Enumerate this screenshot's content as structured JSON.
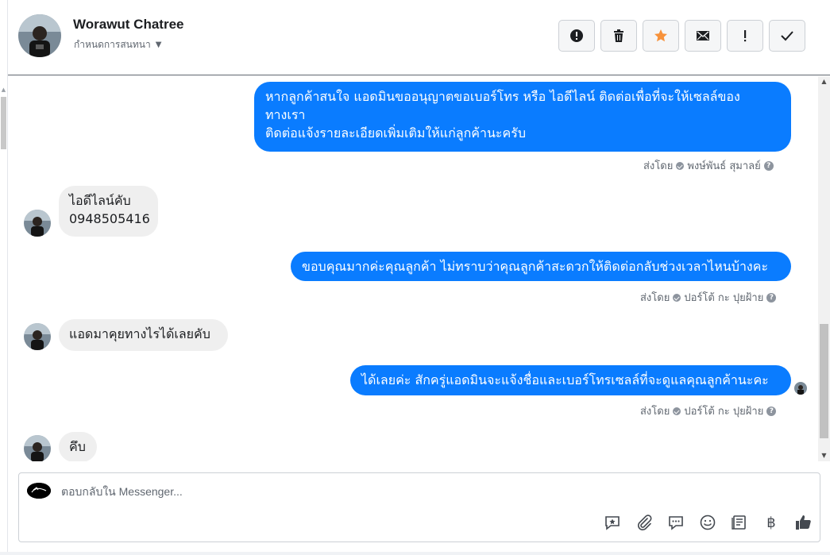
{
  "contact": {
    "name": "Worawut Chatree",
    "assign_label": "กำหนดการสนทนา"
  },
  "header_actions": [
    {
      "name": "spam-button",
      "icon": "alert-icon"
    },
    {
      "name": "delete-button",
      "icon": "trash-icon"
    },
    {
      "name": "star-button",
      "icon": "star-icon",
      "color": "#f7923b"
    },
    {
      "name": "mark-unread-button",
      "icon": "envelope-icon"
    },
    {
      "name": "follow-up-button",
      "icon": "exclamation-icon"
    },
    {
      "name": "mark-done-button",
      "icon": "check-icon"
    }
  ],
  "messages": [
    {
      "direction": "out",
      "lines": [
        "หากลูกค้าสนใจ แอดมินขออนุญาตขอเบอร์โทร หรือ ไอดีไลน์ ติดต่อเพื่อที่จะให้เซลล์ของ",
        "ทางเรา",
        "ติดต่อแจ้งรายละเอียดเพิ่มเติมให้แก่ลูกค้านะครับ"
      ],
      "sent_by_label": "ส่งโดย",
      "sender": "พงษ์พันธ์ สุมาลย์"
    },
    {
      "direction": "in",
      "lines": [
        "ไอดีไลน์คับ",
        "0948505416"
      ]
    },
    {
      "direction": "out",
      "lines": [
        "ขอบคุณมากค่ะคุณลูกค้า ไม่ทราบว่าคุณลูกค้าสะดวกให้ติดต่อกลับช่วงเวลาไหนบ้างคะ"
      ],
      "sent_by_label": "ส่งโดย",
      "sender": "ปอร์โต้ กะ ปุยฝ้าย"
    },
    {
      "direction": "in",
      "lines": [
        "แอดมาคุยทางไรได้เลยคับ"
      ]
    },
    {
      "direction": "out",
      "lines": [
        "ได้เลยค่ะ สักครู่แอดมินจะแจ้งชื่อและเบอร์โทรเซลล์ที่จะดูแลคุณลูกค้านะคะ"
      ],
      "sent_by_label": "ส่งโดย",
      "sender": "ปอร์โต้ กะ ปุยฝ้าย"
    },
    {
      "direction": "in",
      "lines": [
        "คึบ"
      ]
    }
  ],
  "composer": {
    "placeholder": "ตอบกลับใน Messenger...",
    "tools": [
      "saved-reply-icon",
      "attachment-icon",
      "chat-bubble-icon",
      "emoji-icon",
      "notes-icon",
      "baht-icon",
      "thumbs-up-icon"
    ],
    "baht_symbol": "฿"
  },
  "colors": {
    "outgoing_bubble": "#0a7cff",
    "incoming_bubble": "#efefef",
    "star": "#f7923b"
  }
}
